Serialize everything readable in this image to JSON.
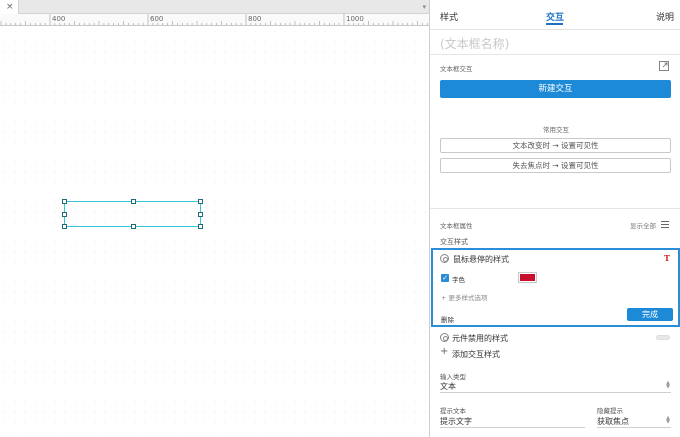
{
  "canvas": {
    "tab_close": "×",
    "tab_dropdown": "▾",
    "ruler_labels": [
      "400",
      "600",
      "800",
      "1000"
    ]
  },
  "panel": {
    "tabs": {
      "style": "样式",
      "interaction": "交互",
      "notes": "说明"
    },
    "widget_name_placeholder": "(文本框名称)",
    "interaction_section_label": "文本框交互",
    "new_interaction_button": "新建交互",
    "common_interactions_label": "常用交互",
    "common_interactions": [
      "文本改变时 → 设置可见性",
      "失去焦点时 → 设置可见性"
    ],
    "properties_label": "文本框属性",
    "show_all": "显示全部",
    "interaction_styles_label": "交互样式",
    "hover_style": {
      "title": "鼠标悬停的样式",
      "font_color_label": "字色",
      "font_color": "#c8102e",
      "more_options": "+ 更多样式选项",
      "delete": "删除",
      "done": "完成"
    },
    "disabled_style_title": "元件禁用的样式",
    "add_interaction_style": "添加交互样式",
    "input_type": {
      "label": "输入类型",
      "value": "文本"
    },
    "hint_text": {
      "label": "提示文本",
      "value": "提示文字"
    },
    "hide_hint": {
      "label": "隐藏提示",
      "value": "获取焦点"
    }
  },
  "colors": {
    "accent": "#1d8ad8",
    "selection": "#37c7d6",
    "swatch": "#c8102e"
  }
}
